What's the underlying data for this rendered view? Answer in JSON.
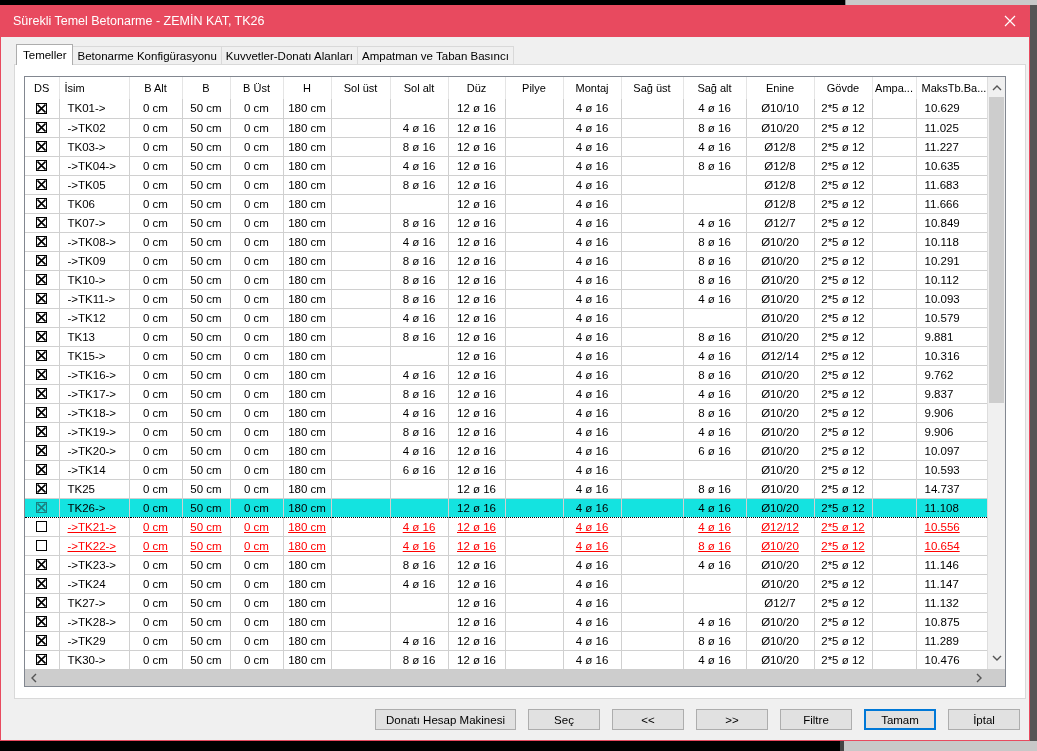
{
  "window": {
    "title": "Sürekli Temel Betonarme - ZEMİN KAT, TK26"
  },
  "tabs": [
    {
      "label": "Temeller",
      "selected": true
    },
    {
      "label": "Betonarme Konfigürasyonu",
      "selected": false
    },
    {
      "label": "Kuvvetler-Donatı Alanları",
      "selected": false
    },
    {
      "label": "Ampatman ve Taban Basıncı",
      "selected": false
    }
  ],
  "table": {
    "checkbox_column": "DS",
    "columns": [
      "İsim",
      "B Alt",
      "B",
      "B Üst",
      "H",
      "Sol üst",
      "Sol alt",
      "Düz",
      "Pilye",
      "Montaj",
      "Sağ üst",
      "Sağ alt",
      "Enine",
      "Gövde",
      "Ampa...",
      "MaksTb.Ba..."
    ],
    "rows": [
      {
        "checked": true,
        "selected": false,
        "flagged": false,
        "cells": [
          "TK01->",
          "0 cm",
          "50 cm",
          "0 cm",
          "180 cm",
          null,
          null,
          "12 ø 16",
          null,
          "4 ø 16",
          null,
          "4 ø 16",
          "Ø10/10",
          "2*5 ø 12",
          null,
          "10.629"
        ]
      },
      {
        "checked": true,
        "selected": false,
        "flagged": false,
        "cells": [
          "->TK02",
          "0 cm",
          "50 cm",
          "0 cm",
          "180 cm",
          null,
          "4 ø 16",
          "12 ø 16",
          null,
          "4 ø 16",
          null,
          "8 ø 16",
          "Ø10/20",
          "2*5 ø 12",
          null,
          "11.025"
        ]
      },
      {
        "checked": true,
        "selected": false,
        "flagged": false,
        "cells": [
          "TK03->",
          "0 cm",
          "50 cm",
          "0 cm",
          "180 cm",
          null,
          "8 ø 16",
          "12 ø 16",
          null,
          "4 ø 16",
          null,
          "4 ø 16",
          "Ø12/8",
          "2*5 ø 12",
          null,
          "11.227"
        ]
      },
      {
        "checked": true,
        "selected": false,
        "flagged": false,
        "cells": [
          "->TK04->",
          "0 cm",
          "50 cm",
          "0 cm",
          "180 cm",
          null,
          "4 ø 16",
          "12 ø 16",
          null,
          "4 ø 16",
          null,
          "8 ø 16",
          "Ø12/8",
          "2*5 ø 12",
          null,
          "10.635"
        ]
      },
      {
        "checked": true,
        "selected": false,
        "flagged": false,
        "cells": [
          "->TK05",
          "0 cm",
          "50 cm",
          "0 cm",
          "180 cm",
          null,
          "8 ø 16",
          "12 ø 16",
          null,
          "4 ø 16",
          null,
          null,
          "Ø12/8",
          "2*5 ø 12",
          null,
          "11.683"
        ]
      },
      {
        "checked": true,
        "selected": false,
        "flagged": false,
        "cells": [
          "TK06",
          "0 cm",
          "50 cm",
          "0 cm",
          "180 cm",
          null,
          null,
          "12 ø 16",
          null,
          "4 ø 16",
          null,
          null,
          "Ø12/8",
          "2*5 ø 12",
          null,
          "11.666"
        ]
      },
      {
        "checked": true,
        "selected": false,
        "flagged": false,
        "cells": [
          "TK07->",
          "0 cm",
          "50 cm",
          "0 cm",
          "180 cm",
          null,
          "8 ø 16",
          "12 ø 16",
          null,
          "4 ø 16",
          null,
          "4 ø 16",
          "Ø12/7",
          "2*5 ø 12",
          null,
          "10.849"
        ]
      },
      {
        "checked": true,
        "selected": false,
        "flagged": false,
        "cells": [
          "->TK08->",
          "0 cm",
          "50 cm",
          "0 cm",
          "180 cm",
          null,
          "4 ø 16",
          "12 ø 16",
          null,
          "4 ø 16",
          null,
          "8 ø 16",
          "Ø10/20",
          "2*5 ø 12",
          null,
          "10.118"
        ]
      },
      {
        "checked": true,
        "selected": false,
        "flagged": false,
        "cells": [
          "->TK09",
          "0 cm",
          "50 cm",
          "0 cm",
          "180 cm",
          null,
          "8 ø 16",
          "12 ø 16",
          null,
          "4 ø 16",
          null,
          "8 ø 16",
          "Ø10/20",
          "2*5 ø 12",
          null,
          "10.291"
        ]
      },
      {
        "checked": true,
        "selected": false,
        "flagged": false,
        "cells": [
          "TK10->",
          "0 cm",
          "50 cm",
          "0 cm",
          "180 cm",
          null,
          "8 ø 16",
          "12 ø 16",
          null,
          "4 ø 16",
          null,
          "8 ø 16",
          "Ø10/20",
          "2*5 ø 12",
          null,
          "10.112"
        ]
      },
      {
        "checked": true,
        "selected": false,
        "flagged": false,
        "cells": [
          "->TK11->",
          "0 cm",
          "50 cm",
          "0 cm",
          "180 cm",
          null,
          "8 ø 16",
          "12 ø 16",
          null,
          "4 ø 16",
          null,
          "4 ø 16",
          "Ø10/20",
          "2*5 ø 12",
          null,
          "10.093"
        ]
      },
      {
        "checked": true,
        "selected": false,
        "flagged": false,
        "cells": [
          "->TK12",
          "0 cm",
          "50 cm",
          "0 cm",
          "180 cm",
          null,
          "4 ø 16",
          "12 ø 16",
          null,
          "4 ø 16",
          null,
          null,
          "Ø10/20",
          "2*5 ø 12",
          null,
          "10.579"
        ]
      },
      {
        "checked": true,
        "selected": false,
        "flagged": false,
        "cells": [
          "TK13",
          "0 cm",
          "50 cm",
          "0 cm",
          "180 cm",
          null,
          "8 ø 16",
          "12 ø 16",
          null,
          "4 ø 16",
          null,
          "8 ø 16",
          "Ø10/20",
          "2*5 ø 12",
          null,
          "9.881"
        ]
      },
      {
        "checked": true,
        "selected": false,
        "flagged": false,
        "cells": [
          "TK15->",
          "0 cm",
          "50 cm",
          "0 cm",
          "180 cm",
          null,
          null,
          "12 ø 16",
          null,
          "4 ø 16",
          null,
          "4 ø 16",
          "Ø12/14",
          "2*5 ø 12",
          null,
          "10.316"
        ]
      },
      {
        "checked": true,
        "selected": false,
        "flagged": false,
        "cells": [
          "->TK16->",
          "0 cm",
          "50 cm",
          "0 cm",
          "180 cm",
          null,
          "4 ø 16",
          "12 ø 16",
          null,
          "4 ø 16",
          null,
          "8 ø 16",
          "Ø10/20",
          "2*5 ø 12",
          null,
          "9.762"
        ]
      },
      {
        "checked": true,
        "selected": false,
        "flagged": false,
        "cells": [
          "->TK17->",
          "0 cm",
          "50 cm",
          "0 cm",
          "180 cm",
          null,
          "8 ø 16",
          "12 ø 16",
          null,
          "4 ø 16",
          null,
          "4 ø 16",
          "Ø10/20",
          "2*5 ø 12",
          null,
          "9.837"
        ]
      },
      {
        "checked": true,
        "selected": false,
        "flagged": false,
        "cells": [
          "->TK18->",
          "0 cm",
          "50 cm",
          "0 cm",
          "180 cm",
          null,
          "4 ø 16",
          "12 ø 16",
          null,
          "4 ø 16",
          null,
          "8 ø 16",
          "Ø10/20",
          "2*5 ø 12",
          null,
          "9.906"
        ]
      },
      {
        "checked": true,
        "selected": false,
        "flagged": false,
        "cells": [
          "->TK19->",
          "0 cm",
          "50 cm",
          "0 cm",
          "180 cm",
          null,
          "8 ø 16",
          "12 ø 16",
          null,
          "4 ø 16",
          null,
          "4 ø 16",
          "Ø10/20",
          "2*5 ø 12",
          null,
          "9.906"
        ]
      },
      {
        "checked": true,
        "selected": false,
        "flagged": false,
        "cells": [
          "->TK20->",
          "0 cm",
          "50 cm",
          "0 cm",
          "180 cm",
          null,
          "4 ø 16",
          "12 ø 16",
          null,
          "4 ø 16",
          null,
          "6 ø 16",
          "Ø10/20",
          "2*5 ø 12",
          null,
          "10.097"
        ]
      },
      {
        "checked": true,
        "selected": false,
        "flagged": false,
        "cells": [
          "->TK14",
          "0 cm",
          "50 cm",
          "0 cm",
          "180 cm",
          null,
          "6 ø 16",
          "12 ø 16",
          null,
          "4 ø 16",
          null,
          null,
          "Ø10/20",
          "2*5 ø 12",
          null,
          "10.593"
        ]
      },
      {
        "checked": true,
        "selected": false,
        "flagged": false,
        "cells": [
          "TK25",
          "0 cm",
          "50 cm",
          "0 cm",
          "180 cm",
          null,
          null,
          "12 ø 16",
          null,
          "4 ø 16",
          null,
          "8 ø 16",
          "Ø10/20",
          "2*5 ø 12",
          null,
          "14.737"
        ]
      },
      {
        "checked": true,
        "selected": true,
        "flagged": false,
        "cells": [
          "TK26->",
          "0 cm",
          "50 cm",
          "0 cm",
          "180 cm",
          null,
          null,
          "12 ø 16",
          null,
          "4 ø 16",
          null,
          "4 ø 16",
          "Ø10/20",
          "2*5 ø 12",
          null,
          "11.108"
        ]
      },
      {
        "checked": false,
        "selected": false,
        "flagged": true,
        "cells": [
          "->TK21->",
          "0 cm",
          "50 cm",
          "0 cm",
          "180 cm",
          null,
          "4 ø 16",
          "12 ø 16",
          null,
          "4 ø 16",
          null,
          "4 ø 16",
          "Ø12/12",
          "2*5 ø 12",
          null,
          "10.556"
        ]
      },
      {
        "checked": false,
        "selected": false,
        "flagged": true,
        "cells": [
          "->TK22->",
          "0 cm",
          "50 cm",
          "0 cm",
          "180 cm",
          null,
          "4 ø 16",
          "12 ø 16",
          null,
          "4 ø 16",
          null,
          "8 ø 16",
          "Ø10/20",
          "2*5 ø 12",
          null,
          "10.654"
        ]
      },
      {
        "checked": true,
        "selected": false,
        "flagged": false,
        "cells": [
          "->TK23->",
          "0 cm",
          "50 cm",
          "0 cm",
          "180 cm",
          null,
          "8 ø 16",
          "12 ø 16",
          null,
          "4 ø 16",
          null,
          "4 ø 16",
          "Ø10/20",
          "2*5 ø 12",
          null,
          "11.146"
        ]
      },
      {
        "checked": true,
        "selected": false,
        "flagged": false,
        "cells": [
          "->TK24",
          "0 cm",
          "50 cm",
          "0 cm",
          "180 cm",
          null,
          "4 ø 16",
          "12 ø 16",
          null,
          "4 ø 16",
          null,
          null,
          "Ø10/20",
          "2*5 ø 12",
          null,
          "11.147"
        ]
      },
      {
        "checked": true,
        "selected": false,
        "flagged": false,
        "cells": [
          "TK27->",
          "0 cm",
          "50 cm",
          "0 cm",
          "180 cm",
          null,
          null,
          "12 ø 16",
          null,
          "4 ø 16",
          null,
          null,
          "Ø12/7",
          "2*5 ø 12",
          null,
          "11.132"
        ]
      },
      {
        "checked": true,
        "selected": false,
        "flagged": false,
        "cells": [
          "->TK28->",
          "0 cm",
          "50 cm",
          "0 cm",
          "180 cm",
          null,
          null,
          "12 ø 16",
          null,
          "4 ø 16",
          null,
          "4 ø 16",
          "Ø10/20",
          "2*5 ø 12",
          null,
          "10.875"
        ]
      },
      {
        "checked": true,
        "selected": false,
        "flagged": false,
        "cells": [
          "->TK29",
          "0 cm",
          "50 cm",
          "0 cm",
          "180 cm",
          null,
          "4 ø 16",
          "12 ø 16",
          null,
          "4 ø 16",
          null,
          "8 ø 16",
          "Ø10/20",
          "2*5 ø 12",
          null,
          "11.289"
        ]
      },
      {
        "checked": true,
        "selected": false,
        "flagged": false,
        "cells": [
          "TK30->",
          "0 cm",
          "50 cm",
          "0 cm",
          "180 cm",
          null,
          "8 ø 16",
          "12 ø 16",
          null,
          "4 ø 16",
          null,
          "4 ø 16",
          "Ø10/20",
          "2*5 ø 12",
          null,
          "10.476"
        ]
      }
    ]
  },
  "buttons": [
    {
      "label": "Donatı Hesap Makinesi",
      "focused": false
    },
    {
      "label": "Seç",
      "focused": false
    },
    {
      "label": "<<",
      "focused": false
    },
    {
      "label": ">>",
      "focused": false
    },
    {
      "label": "Filtre",
      "focused": false
    },
    {
      "label": "Tamam",
      "focused": true
    },
    {
      "label": "İptal",
      "focused": false
    }
  ]
}
